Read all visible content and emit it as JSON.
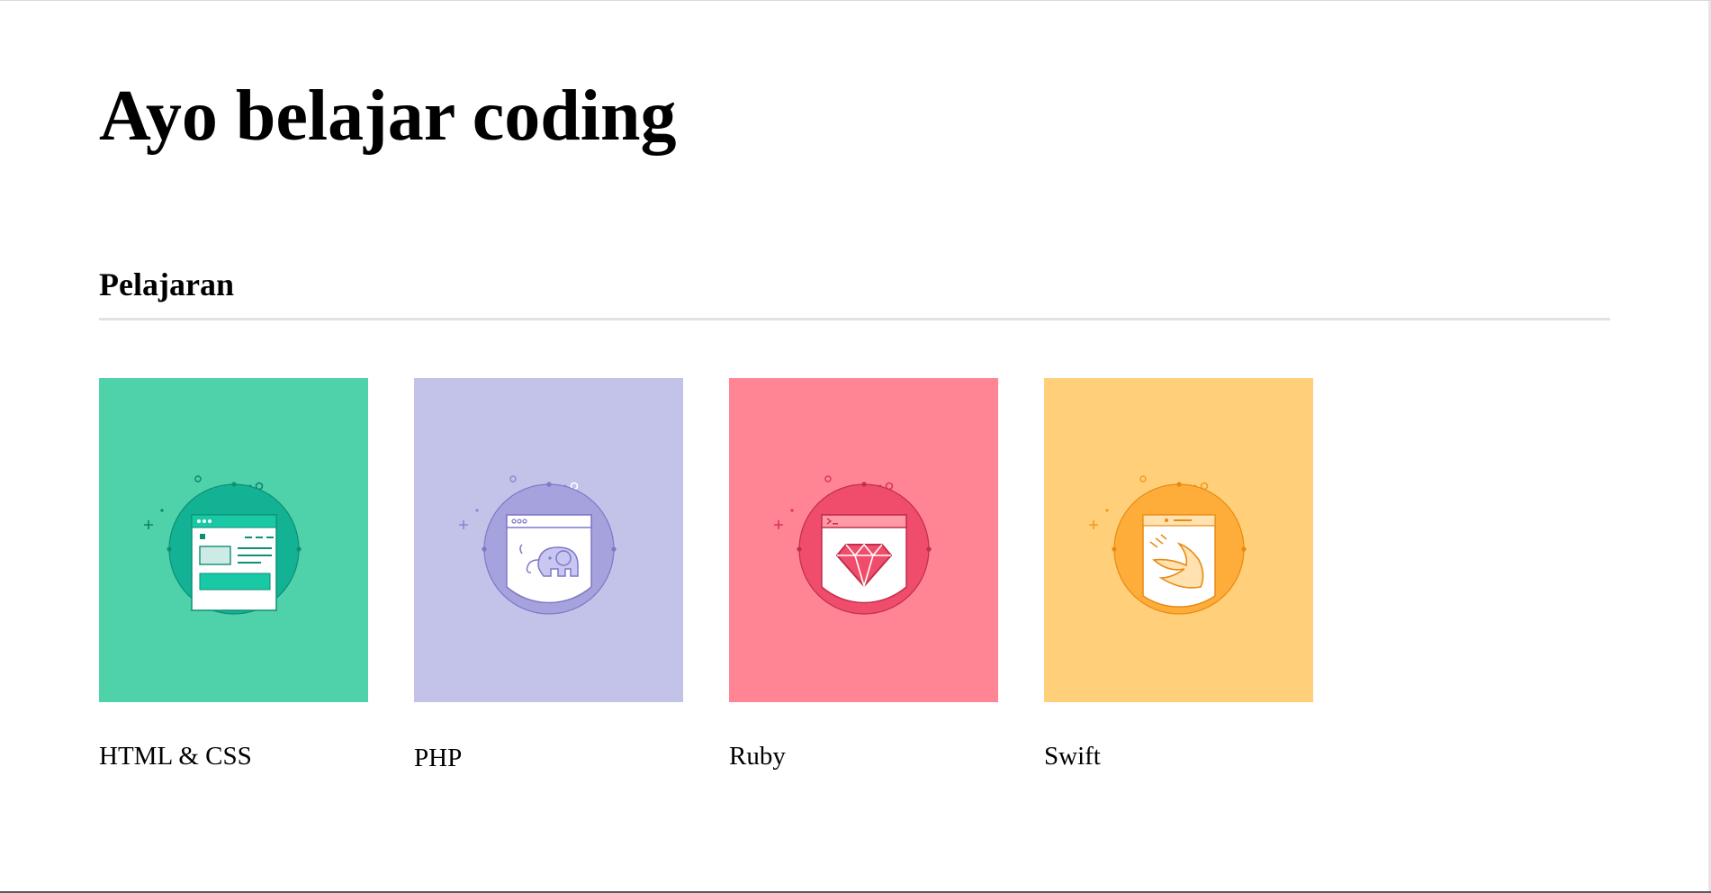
{
  "page": {
    "title": "Ayo belajar coding",
    "section_title": "Pelajaran"
  },
  "lessons": [
    {
      "label": "HTML & CSS",
      "icon": "html-css-window-icon",
      "colors": {
        "bg": "#4fd1aa",
        "circle": "#13b294",
        "dark": "#0d8f76",
        "accent": "#19c9a5",
        "light": "#cdebe4",
        "spark": "#10806a"
      }
    },
    {
      "label": "PHP",
      "icon": "php-elephant-icon",
      "colors": {
        "bg": "#c3c3ea",
        "circle": "#a5a2dd",
        "dark": "#7e79c6",
        "accent": "#b6b3e8",
        "light": "#c9c6f2",
        "spark": "#8a86cf"
      }
    },
    {
      "label": "Ruby",
      "icon": "ruby-gem-icon",
      "colors": {
        "bg": "#ff8595",
        "circle": "#ef4d6b",
        "dark": "#c22e4b",
        "accent": "#ff9aa6",
        "light": "#ffb6bf",
        "spark": "#d93656"
      }
    },
    {
      "label": "Swift",
      "icon": "swift-bird-icon",
      "colors": {
        "bg": "#ffcf79",
        "circle": "#ffad3a",
        "dark": "#e88a12",
        "accent": "#ffd08a",
        "light": "#ffe2b0",
        "spark": "#f29a1f"
      }
    }
  ]
}
